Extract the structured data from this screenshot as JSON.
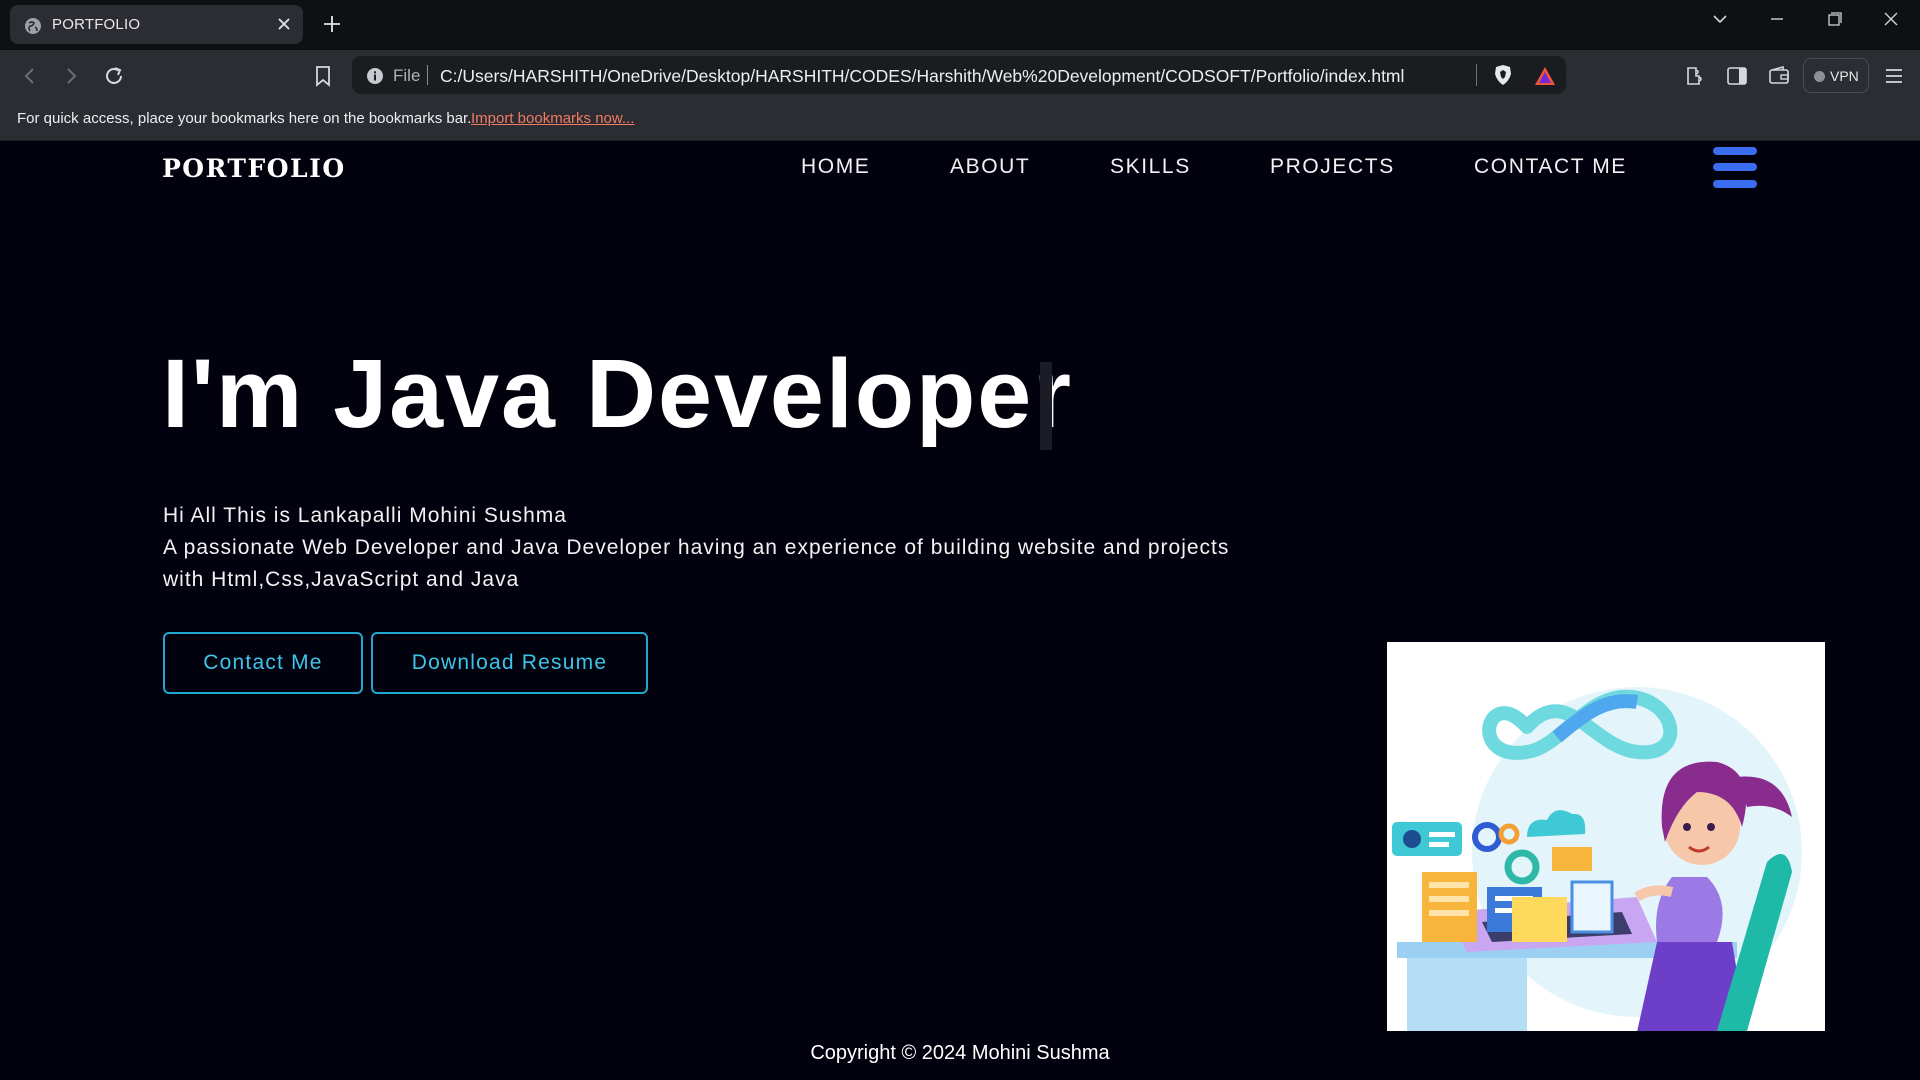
{
  "browser": {
    "tab": {
      "title": "PORTFOLIO",
      "favicon": "globe-icon"
    },
    "omnibox": {
      "scheme": "File",
      "url": "C:/Users/HARSHITH/OneDrive/Desktop/HARSHITH/CODES/Harshith/Web%20Development/CODSOFT/Portfolio/index.html"
    },
    "vpn_label": "VPN",
    "bookmarks_bar": {
      "message": "For quick access, place your bookmarks here on the bookmarks bar.",
      "link": "Import bookmarks now..."
    }
  },
  "site": {
    "logo": "PORTFOLIO",
    "nav": [
      "HOME",
      "ABOUT",
      "SKILLS",
      "PROJECTS",
      "CONTACT ME"
    ],
    "hero": {
      "headline": "I'm Java Developer",
      "intro_line1": "Hi All This is Lankapalli Mohini Sushma",
      "intro_line2": "A passionate Web Developer and Java Developer having an experience of building website and projects",
      "intro_line3": "with Html,Css,JavaScript and Java",
      "buttons": {
        "contact": "Contact Me",
        "resume": "Download Resume"
      }
    },
    "footer": "Copyright © 2024 Mohini Sushma"
  },
  "colors": {
    "page_background": "#02020e",
    "accent_cyan": "#21a8cf",
    "menu_blue": "#3b6df0",
    "link_orange": "#f07a62"
  }
}
